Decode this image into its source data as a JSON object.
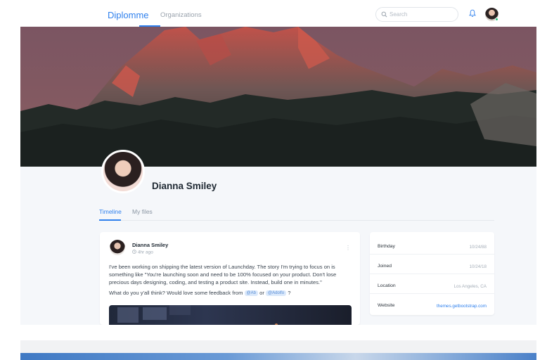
{
  "nav": {
    "brand": "Diplomme",
    "organizations": "Organizations",
    "search_placeholder": "Search"
  },
  "profile": {
    "name": "Dianna Smiley"
  },
  "tabs": [
    {
      "label": "Timeline",
      "active": true
    },
    {
      "label": "My files",
      "active": false
    }
  ],
  "post": {
    "author": "Dianna Smiley",
    "time": "4hr ago",
    "text": "I've been working on shipping the latest version of Launchday. The story I'm trying to focus on is something like \"You're launching soon and need to be 100% focused on your product. Don't lose precious days designing, coding, and testing a product site. Instead, build one in minutes.\"",
    "question": "What do you y'all think? Would love some feedback from",
    "mention1": "@Ab",
    "mention_join": "or",
    "mention2": "@Adolfo",
    "question_end": "?"
  },
  "info": [
    {
      "label": "Birthday",
      "value": "10/24/88"
    },
    {
      "label": "Joined",
      "value": "10/24/18"
    },
    {
      "label": "Location",
      "value": "Los Angeles, CA"
    },
    {
      "label": "Website",
      "value": "themes.getbootstrap.com"
    }
  ],
  "colors": {
    "accent": "#2f80ed",
    "page_bg": "#f5f7fa",
    "online": "#2ec27e"
  },
  "icons": {
    "search": "search-icon",
    "notifications": "bell-icon",
    "more": "kebab-icon"
  }
}
